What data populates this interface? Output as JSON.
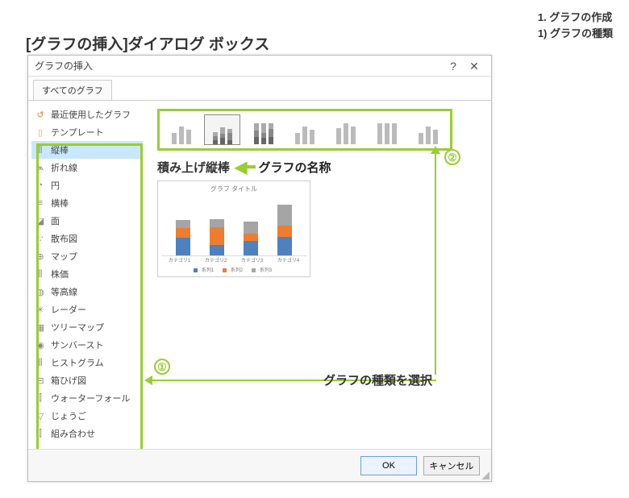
{
  "page": {
    "title": "[グラフの挿入]ダイアログ ボックス",
    "header_line1": "1. グラフの作成",
    "header_line2": "1) グラフの種類"
  },
  "dialog": {
    "title": "グラフの挿入",
    "help": "?",
    "close": "✕",
    "tab": "すべてのグラフ",
    "ok": "OK",
    "cancel": "キャンセル"
  },
  "sidebar": {
    "items": [
      {
        "icon": "↺",
        "label": "最近使用したグラフ"
      },
      {
        "icon": "▯",
        "label": "テンプレート"
      },
      {
        "icon": "⫼",
        "label": "縦棒"
      },
      {
        "icon": "⩕",
        "label": "折れ線"
      },
      {
        "icon": "◔",
        "label": "円"
      },
      {
        "icon": "≡",
        "label": "横棒"
      },
      {
        "icon": "◪",
        "label": "面"
      },
      {
        "icon": "∵",
        "label": "散布図"
      },
      {
        "icon": "⊕",
        "label": "マップ"
      },
      {
        "icon": "⫼",
        "label": "株価"
      },
      {
        "icon": "◍",
        "label": "等高線"
      },
      {
        "icon": "✳",
        "label": "レーダー"
      },
      {
        "icon": "▦",
        "label": "ツリーマップ"
      },
      {
        "icon": "◉",
        "label": "サンバースト"
      },
      {
        "icon": "⫼",
        "label": "ヒストグラム"
      },
      {
        "icon": "⊟",
        "label": "箱ひげ図"
      },
      {
        "icon": "⫿",
        "label": "ウォーターフォール"
      },
      {
        "icon": "▽",
        "label": "じょうご"
      },
      {
        "icon": "⫿",
        "label": "組み合わせ"
      }
    ]
  },
  "subtype": {
    "name": "積み上げ縦棒",
    "annotation_name": "グラフの名称",
    "annotation_select": "グラフの種類を選択",
    "circle1": "①",
    "circle2": "②"
  },
  "chart_data": {
    "type": "bar",
    "stacked": true,
    "title": "グラフ タイトル",
    "categories": [
      "カテゴリ1",
      "カテゴリ2",
      "カテゴリ3",
      "カテゴリ4"
    ],
    "series": [
      {
        "name": "系列1",
        "values": [
          4.3,
          2.5,
          3.5,
          4.5
        ]
      },
      {
        "name": "系列2",
        "values": [
          2.4,
          4.4,
          1.8,
          2.8
        ]
      },
      {
        "name": "系列3",
        "values": [
          2.0,
          2.0,
          3.0,
          5.0
        ]
      }
    ],
    "ylim": [
      0,
      14
    ],
    "xlabel": "",
    "ylabel": ""
  }
}
